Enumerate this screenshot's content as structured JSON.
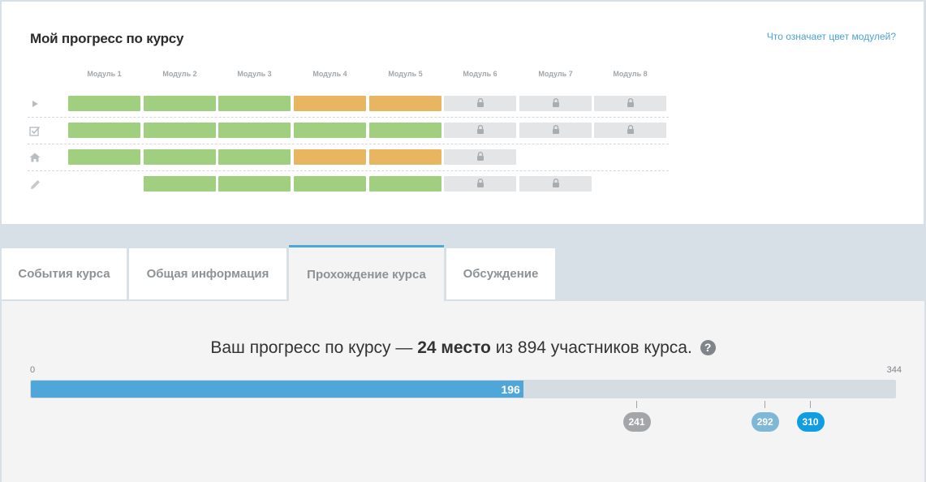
{
  "card": {
    "title": "Мой прогресс по курсу",
    "help_link": "Что означает цвет модулей?"
  },
  "modules": [
    "Модуль 1",
    "Модуль 2",
    "Модуль 3",
    "Модуль 4",
    "Модуль 5",
    "Модуль 6",
    "Модуль 7",
    "Модуль 8"
  ],
  "rows": [
    {
      "icon": "play-icon",
      "cells": [
        "green",
        "green",
        "green",
        "orange",
        "orange",
        "locked",
        "locked",
        "locked"
      ]
    },
    {
      "icon": "checkbox-icon",
      "cells": [
        "green",
        "green",
        "green",
        "green",
        "green",
        "locked",
        "locked",
        "locked"
      ]
    },
    {
      "icon": "home-icon",
      "cells": [
        "green",
        "green",
        "green",
        "orange",
        "orange",
        "locked",
        "none",
        "none"
      ]
    },
    {
      "icon": "pencil-icon",
      "cells": [
        "none",
        "green",
        "green",
        "green",
        "green",
        "locked",
        "locked",
        "none"
      ]
    }
  ],
  "colors": {
    "green": "#a1cf80",
    "orange": "#e8b660",
    "locked": "#e3e5e6",
    "accent": "#4ea7d8"
  },
  "tabs": [
    {
      "label": "События курса",
      "active": false
    },
    {
      "label": "Общая информация",
      "active": false
    },
    {
      "label": "Прохождение курса",
      "active": true
    },
    {
      "label": "Обсуждение",
      "active": false
    }
  ],
  "progress": {
    "text_before": "Ваш прогресс по курсу — ",
    "place": "24 место",
    "text_after": " из 894 участников курса.",
    "help_symbol": "?",
    "min": 0,
    "max": 344,
    "value": 196,
    "markers": [
      {
        "value": 241,
        "color": "#a3a6a9"
      },
      {
        "value": 292,
        "color": "#7fb7d6"
      },
      {
        "value": 310,
        "color": "#119de0"
      }
    ]
  }
}
